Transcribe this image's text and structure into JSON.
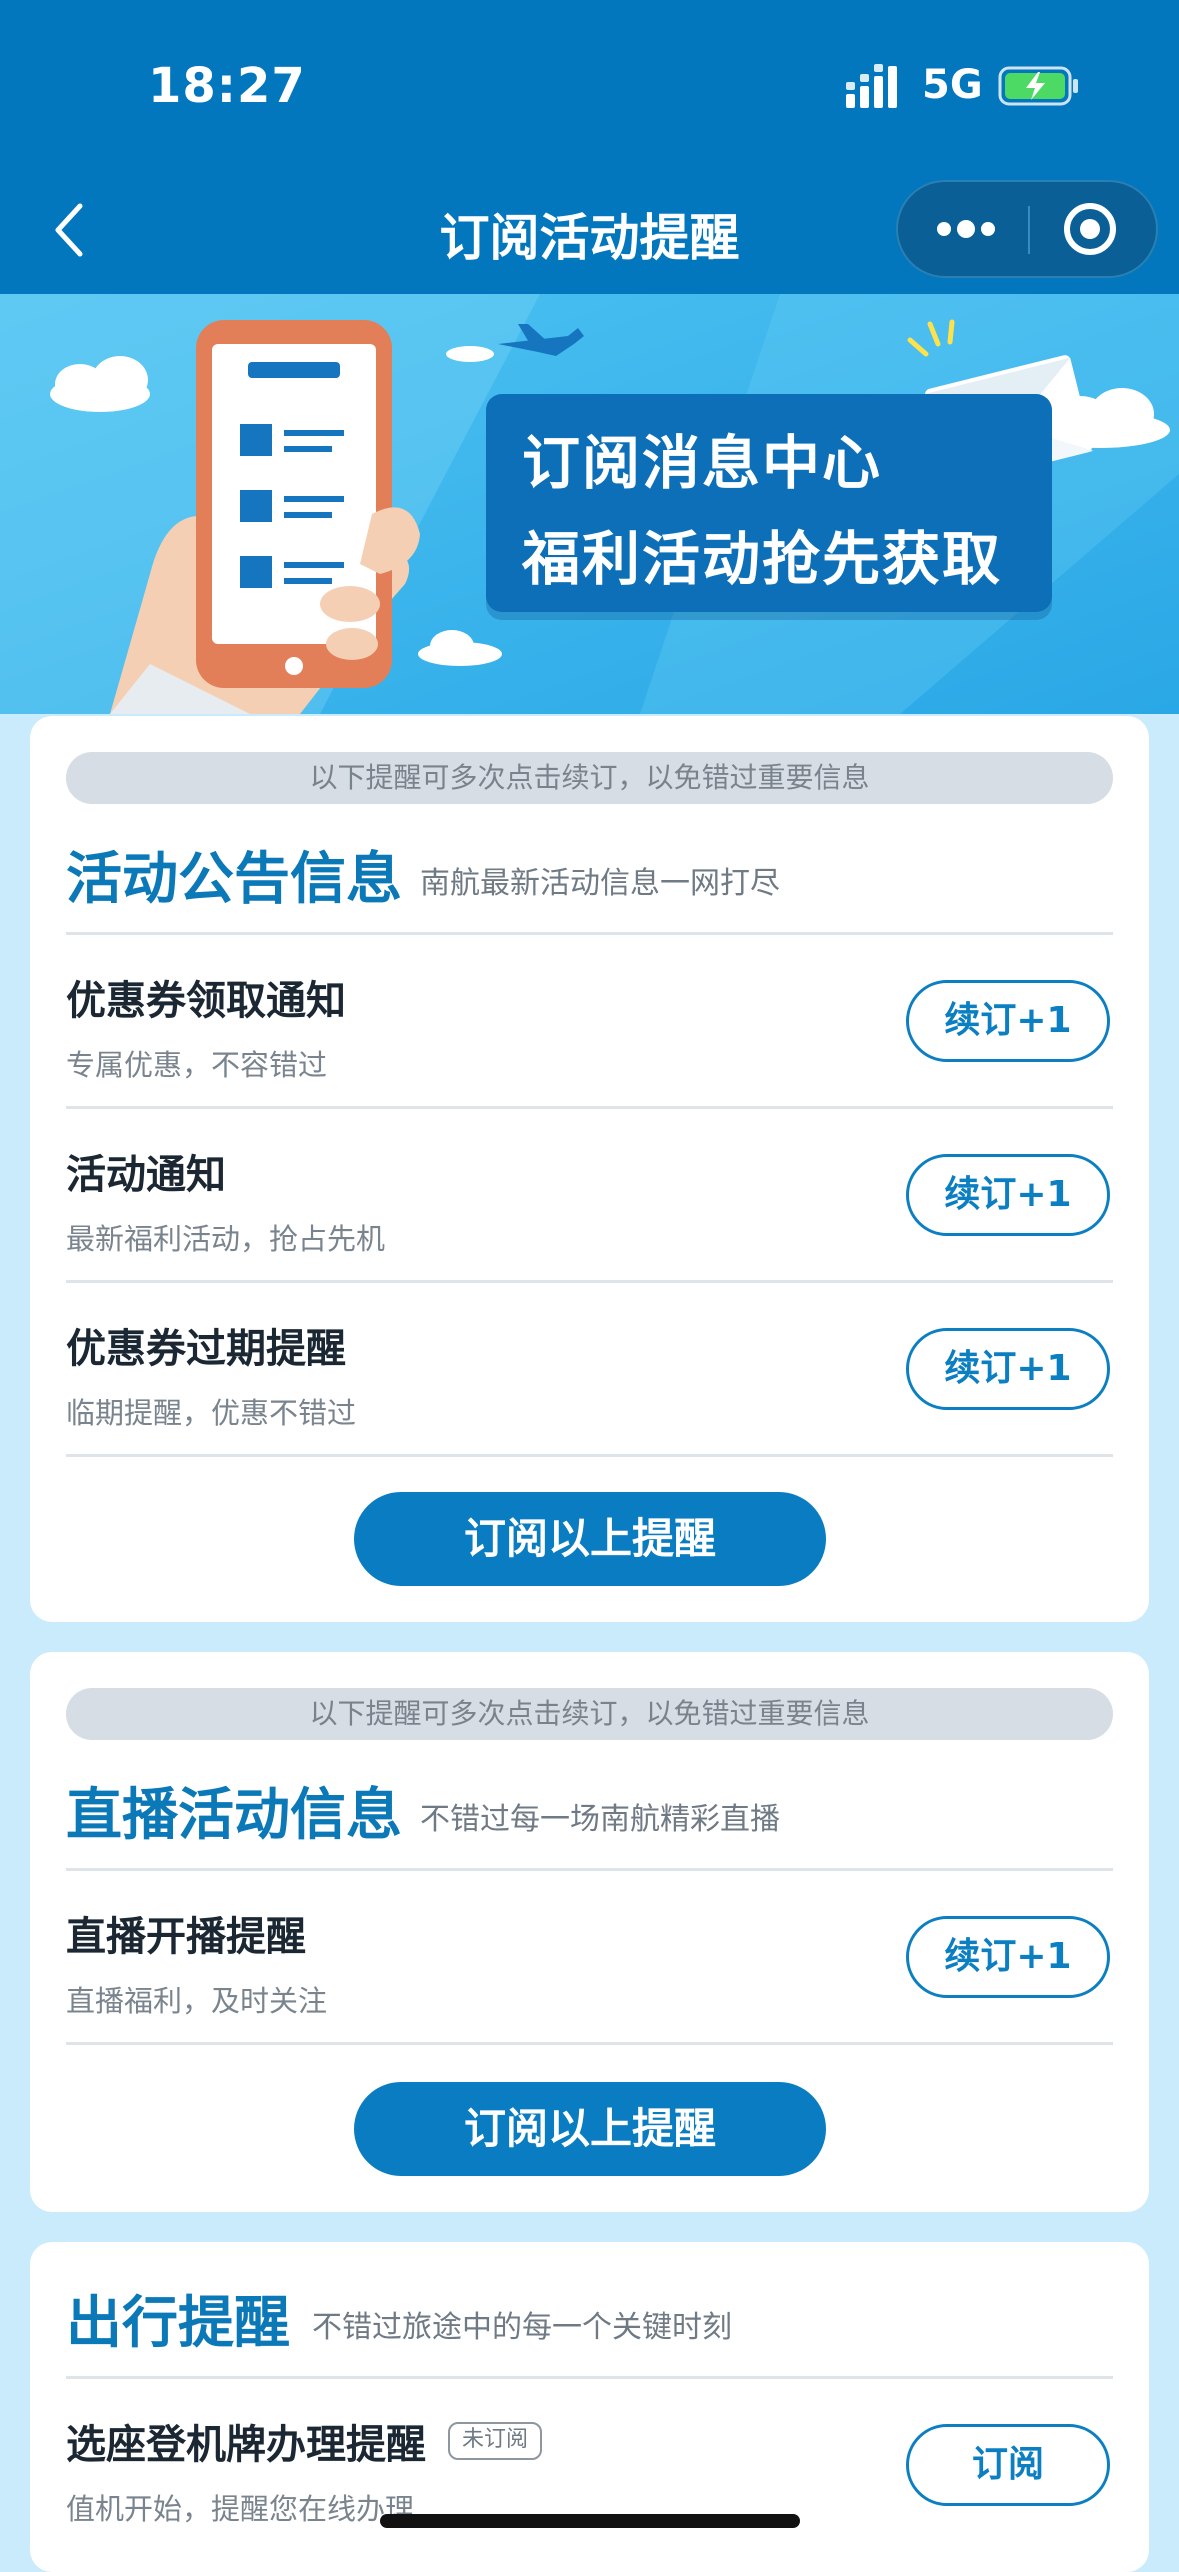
{
  "status_bar": {
    "time": "18:27",
    "network": "5G"
  },
  "nav": {
    "title": "订阅活动提醒"
  },
  "banner": {
    "line1": "订阅消息中心",
    "line2": "福利活动抢先获取"
  },
  "sections": [
    {
      "hint": "以下提醒可多次点击续订，以免错过重要信息",
      "title": "活动公告信息",
      "subtitle": "南航最新活动信息一网打尽",
      "items": [
        {
          "title": "优惠券领取通知",
          "subtitle": "专属优惠，不容错过",
          "action": "续订+1"
        },
        {
          "title": "活动通知",
          "subtitle": "最新福利活动，抢占先机",
          "action": "续订+1"
        },
        {
          "title": "优惠券过期提醒",
          "subtitle": "临期提醒，优惠不错过",
          "action": "续订+1"
        }
      ],
      "button": "订阅以上提醒"
    },
    {
      "hint": "以下提醒可多次点击续订，以免错过重要信息",
      "title": "直播活动信息",
      "subtitle": "不错过每一场南航精彩直播",
      "items": [
        {
          "title": "直播开播提醒",
          "subtitle": "直播福利，及时关注",
          "action": "续订+1"
        }
      ],
      "button": "订阅以上提醒"
    },
    {
      "title": "出行提醒",
      "subtitle": "不错过旅途中的每一个关键时刻",
      "items": [
        {
          "title": "选座登机牌办理提醒",
          "badge": "未订阅",
          "subtitle": "值机开始，提醒您在线办理",
          "action": "订阅"
        }
      ]
    }
  ],
  "colors": {
    "primary": "#0277bd",
    "accent": "#0b78b8",
    "button": "#0a7cc1",
    "page_bg": "#c9ebfb"
  }
}
